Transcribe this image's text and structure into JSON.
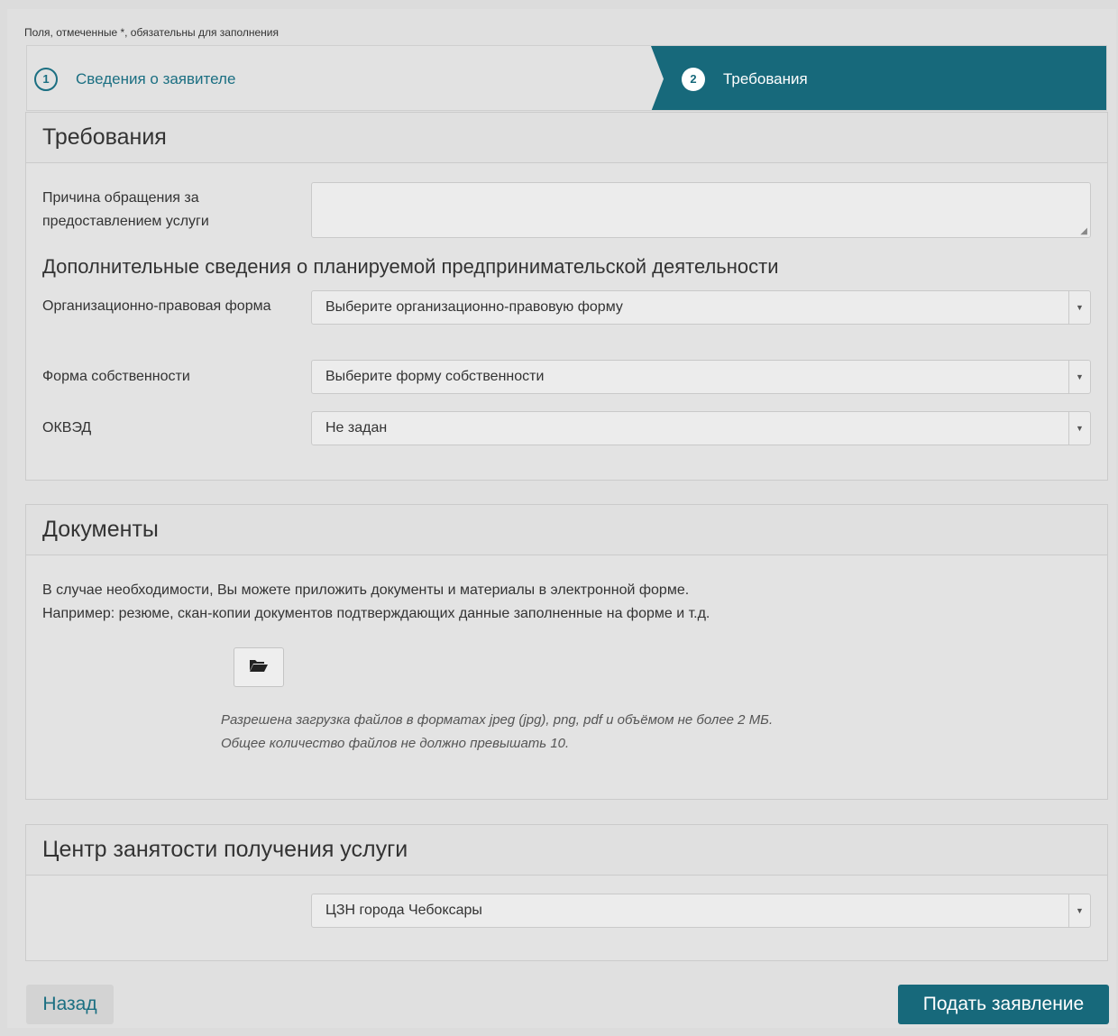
{
  "required_note": "Поля, отмеченные *, обязательны для заполнения",
  "steps": [
    {
      "number": "1",
      "label": "Сведения о заявителе"
    },
    {
      "number": "2",
      "label": "Требования"
    }
  ],
  "requirements": {
    "title": "Требования",
    "reason_label": "Причина обращения за предоставлением услуги",
    "reason_value": "",
    "subheading": "Дополнительные сведения о планируемой предпринимательской деятельности",
    "org_form_label": "Организационно-правовая форма",
    "org_form_value": "Выберите организационно-правовую форму",
    "ownership_label": "Форма собственности",
    "ownership_value": "Выберите форму собственности",
    "okved_label": "ОКВЭД",
    "okved_value": "Не задан"
  },
  "documents": {
    "title": "Документы",
    "text_line1": "В случае необходимости, Вы можете приложить документы и материалы в электронной форме.",
    "text_line2": "Например: резюме, скан-копии документов подтверждающих данные заполненные на форме и т.д.",
    "upload_icon": "folder-open-icon",
    "hint_line1": "Разрешена загрузка файлов в форматах jpeg (jpg), png, pdf и объёмом не более 2 МБ.",
    "hint_line2": "Общее количество файлов не должно превышать 10."
  },
  "center": {
    "title": "Центр занятости получения услуги",
    "value": "ЦЗН города Чебоксары"
  },
  "buttons": {
    "back": "Назад",
    "submit": "Подать заявление"
  },
  "colors": {
    "accent": "#17697b",
    "background": "#e0e0e0"
  }
}
